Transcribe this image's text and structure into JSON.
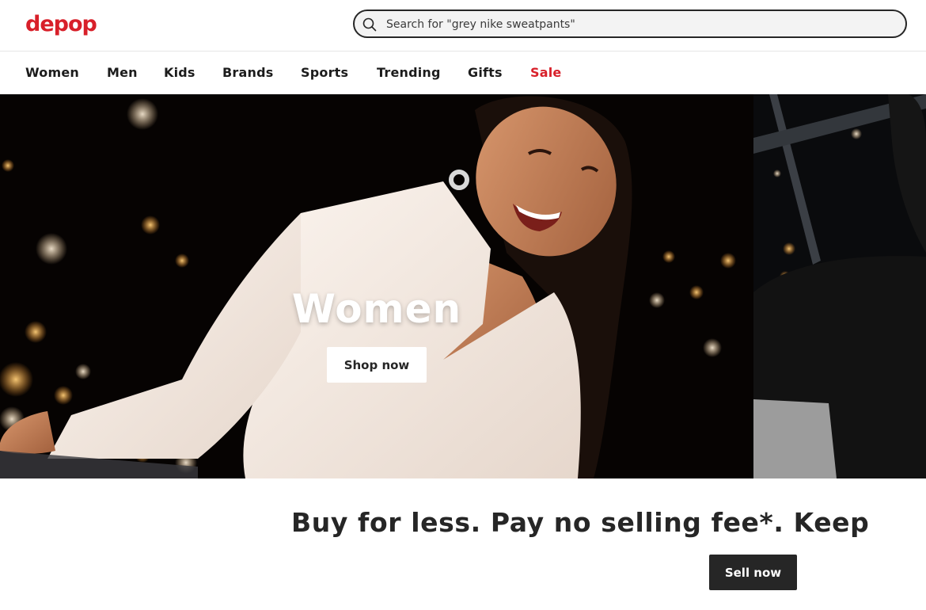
{
  "header": {
    "logo": "depop",
    "search": {
      "placeholder": "Search for \"grey nike sweatpants\""
    }
  },
  "nav": {
    "items": [
      "Women",
      "Men",
      "Kids",
      "Brands",
      "Sports",
      "Trending",
      "Gifts",
      "Sale"
    ]
  },
  "hero": {
    "title": "Women",
    "cta": "Shop now"
  },
  "promo": {
    "headline": "Buy for less. Pay no selling fee*. Keep",
    "cta": "Sell now"
  },
  "colors": {
    "brand": "#d8202a",
    "text": "#262626",
    "sale": "#d8202a",
    "dark_button": "#262626"
  }
}
